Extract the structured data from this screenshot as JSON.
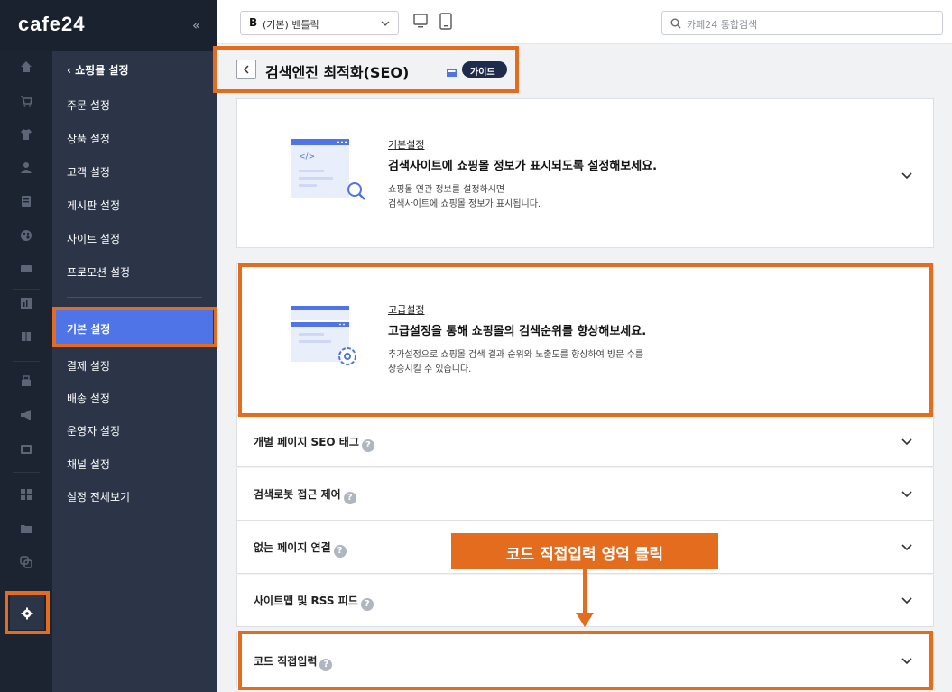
{
  "brand": {
    "logo": "cafe24",
    "collapse_icon": "double-chevron-left-icon"
  },
  "header": {
    "theme_badge": "B",
    "theme_select": "(기본) 벤틀릭",
    "search_placeholder": "카페24 통합검색"
  },
  "nav": {
    "back_label": "‹ 쇼핑몰 설정",
    "items": [
      "주문 설정",
      "상품 설정",
      "고객 설정",
      "게시판 설정",
      "사이트 설정",
      "프로모션 설정"
    ],
    "items2": [
      "기본 설정",
      "결제 설정",
      "배송 설정",
      "운영자 설정",
      "채널 설정",
      "설정 전체보기"
    ]
  },
  "page": {
    "title": "검색엔진 최적화(SEO)",
    "guide": "가이드"
  },
  "cards": [
    {
      "tag": "기본설정",
      "title": "검색사이트에 쇼핑몰 정보가 표시되도록 설정해보세요.",
      "desc1": "쇼핑몰 연관 정보를 설정하시면",
      "desc2": "검색사이트에 쇼핑몰 정보가 표시됩니다."
    },
    {
      "tag": "고급설정",
      "title": "고급설정을 통해 쇼핑몰의 검색순위를 향상해보세요.",
      "desc1": "추가설정으로 쇼핑몰 검색 결과 순위와 노출도를 향상하여 방문 수를",
      "desc2": "상승시킬 수 있습니다."
    }
  ],
  "rows": [
    "개별 페이지 SEO 태그",
    "검색로봇 접근 제어",
    "없는 페이지 연결",
    "사이트맵 및 RSS 피드",
    "코드 직접입력"
  ],
  "callout": "코드 직접입력 영역 클릭",
  "colors": {
    "highlight": "#e46c1e",
    "rail": "#1c2431",
    "nav": "#2b3547",
    "active": "#4f74e7"
  }
}
